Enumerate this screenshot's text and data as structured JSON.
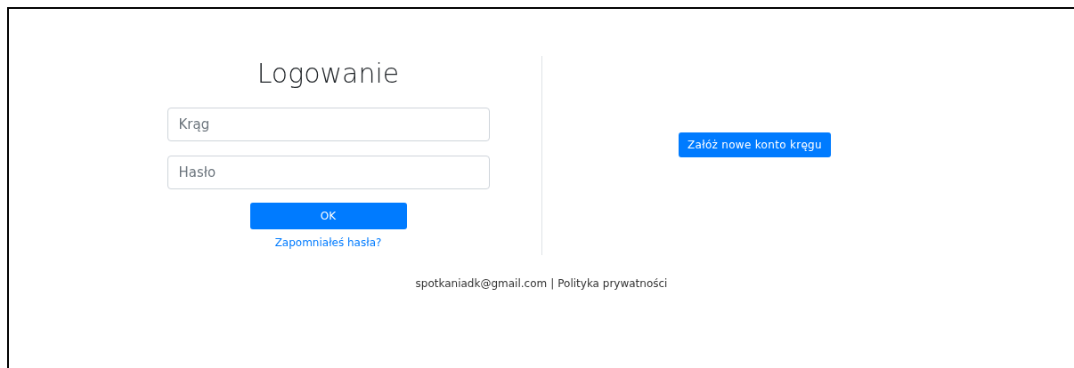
{
  "login": {
    "title": "Logowanie",
    "fields": [
      {
        "placeholder": "Krąg"
      },
      {
        "placeholder": "Hasło"
      }
    ],
    "submit": "OK",
    "forgot_link": "Zapomniałeś hasła?"
  },
  "register": {
    "button": "Załóż nowe konto kręgu"
  },
  "footer": {
    "email": "spotkaniadk@gmail.com",
    "separator": "|",
    "privacy_link": "Polityka prywatności"
  }
}
